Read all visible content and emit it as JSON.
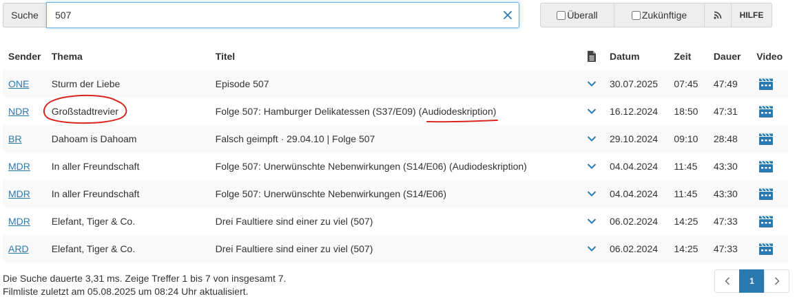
{
  "search": {
    "label": "Suche",
    "value": "507"
  },
  "toolbar": {
    "overall_label": "Überall",
    "future_label": "Zukünftige",
    "help_label": "HILFE"
  },
  "table": {
    "headers": {
      "sender": "Sender",
      "thema": "Thema",
      "titel": "Titel",
      "datum": "Datum",
      "zeit": "Zeit",
      "dauer": "Dauer",
      "video": "Video"
    },
    "rows": [
      {
        "sender": "ONE",
        "thema": "Sturm der Liebe",
        "titel": "Episode 507",
        "datum": "30.07.2025",
        "zeit": "07:45",
        "dauer": "47:49"
      },
      {
        "sender": "NDR",
        "thema": "Großstadtrevier",
        "titel": "Folge 507: Hamburger Delikatessen (S37/E09) (Audiodeskription)",
        "datum": "16.12.2024",
        "zeit": "18:50",
        "dauer": "47:31"
      },
      {
        "sender": "BR",
        "thema": "Dahoam is Dahoam",
        "titel": "Falsch geimpft · 29.04.10 | Folge 507",
        "datum": "29.10.2024",
        "zeit": "09:10",
        "dauer": "28:48"
      },
      {
        "sender": "MDR",
        "thema": "In aller Freundschaft",
        "titel": "Folge 507: Unerwünschte Nebenwirkungen (S14/E06) (Audiodeskription)",
        "datum": "04.04.2024",
        "zeit": "11:45",
        "dauer": "43:30"
      },
      {
        "sender": "MDR",
        "thema": "In aller Freundschaft",
        "titel": "Folge 507: Unerwünschte Nebenwirkungen (S14/E06)",
        "datum": "04.04.2024",
        "zeit": "11:45",
        "dauer": "43:30"
      },
      {
        "sender": "MDR",
        "thema": "Elefant, Tiger & Co.",
        "titel": "Drei Faultiere sind einer zu viel (507)",
        "datum": "06.02.2024",
        "zeit": "14:25",
        "dauer": "47:33"
      },
      {
        "sender": "ARD",
        "thema": "Elefant, Tiger & Co.",
        "titel": "Drei Faultiere sind einer zu viel (507)",
        "datum": "06.02.2024",
        "zeit": "14:25",
        "dauer": "47:33"
      }
    ]
  },
  "footer": {
    "search_info": "Die Suche dauerte 3,31 ms. Zeige Treffer 1 bis 7 von insgesamt 7.",
    "update_info": "Filmliste zuletzt am 05.08.2025 um 08:24 Uhr aktualisiert."
  },
  "pagination": {
    "current": "1"
  },
  "colors": {
    "link": "#2a7ab0",
    "annotation": "#d9231d",
    "stripe": "#f9f9f9"
  },
  "icons": {
    "clear": "close-icon",
    "rss": "rss-icon",
    "description": "document-icon",
    "expand": "chevron-down-icon",
    "video": "video-camera-icon",
    "prev": "chevron-left-icon",
    "next": "chevron-right-icon"
  }
}
